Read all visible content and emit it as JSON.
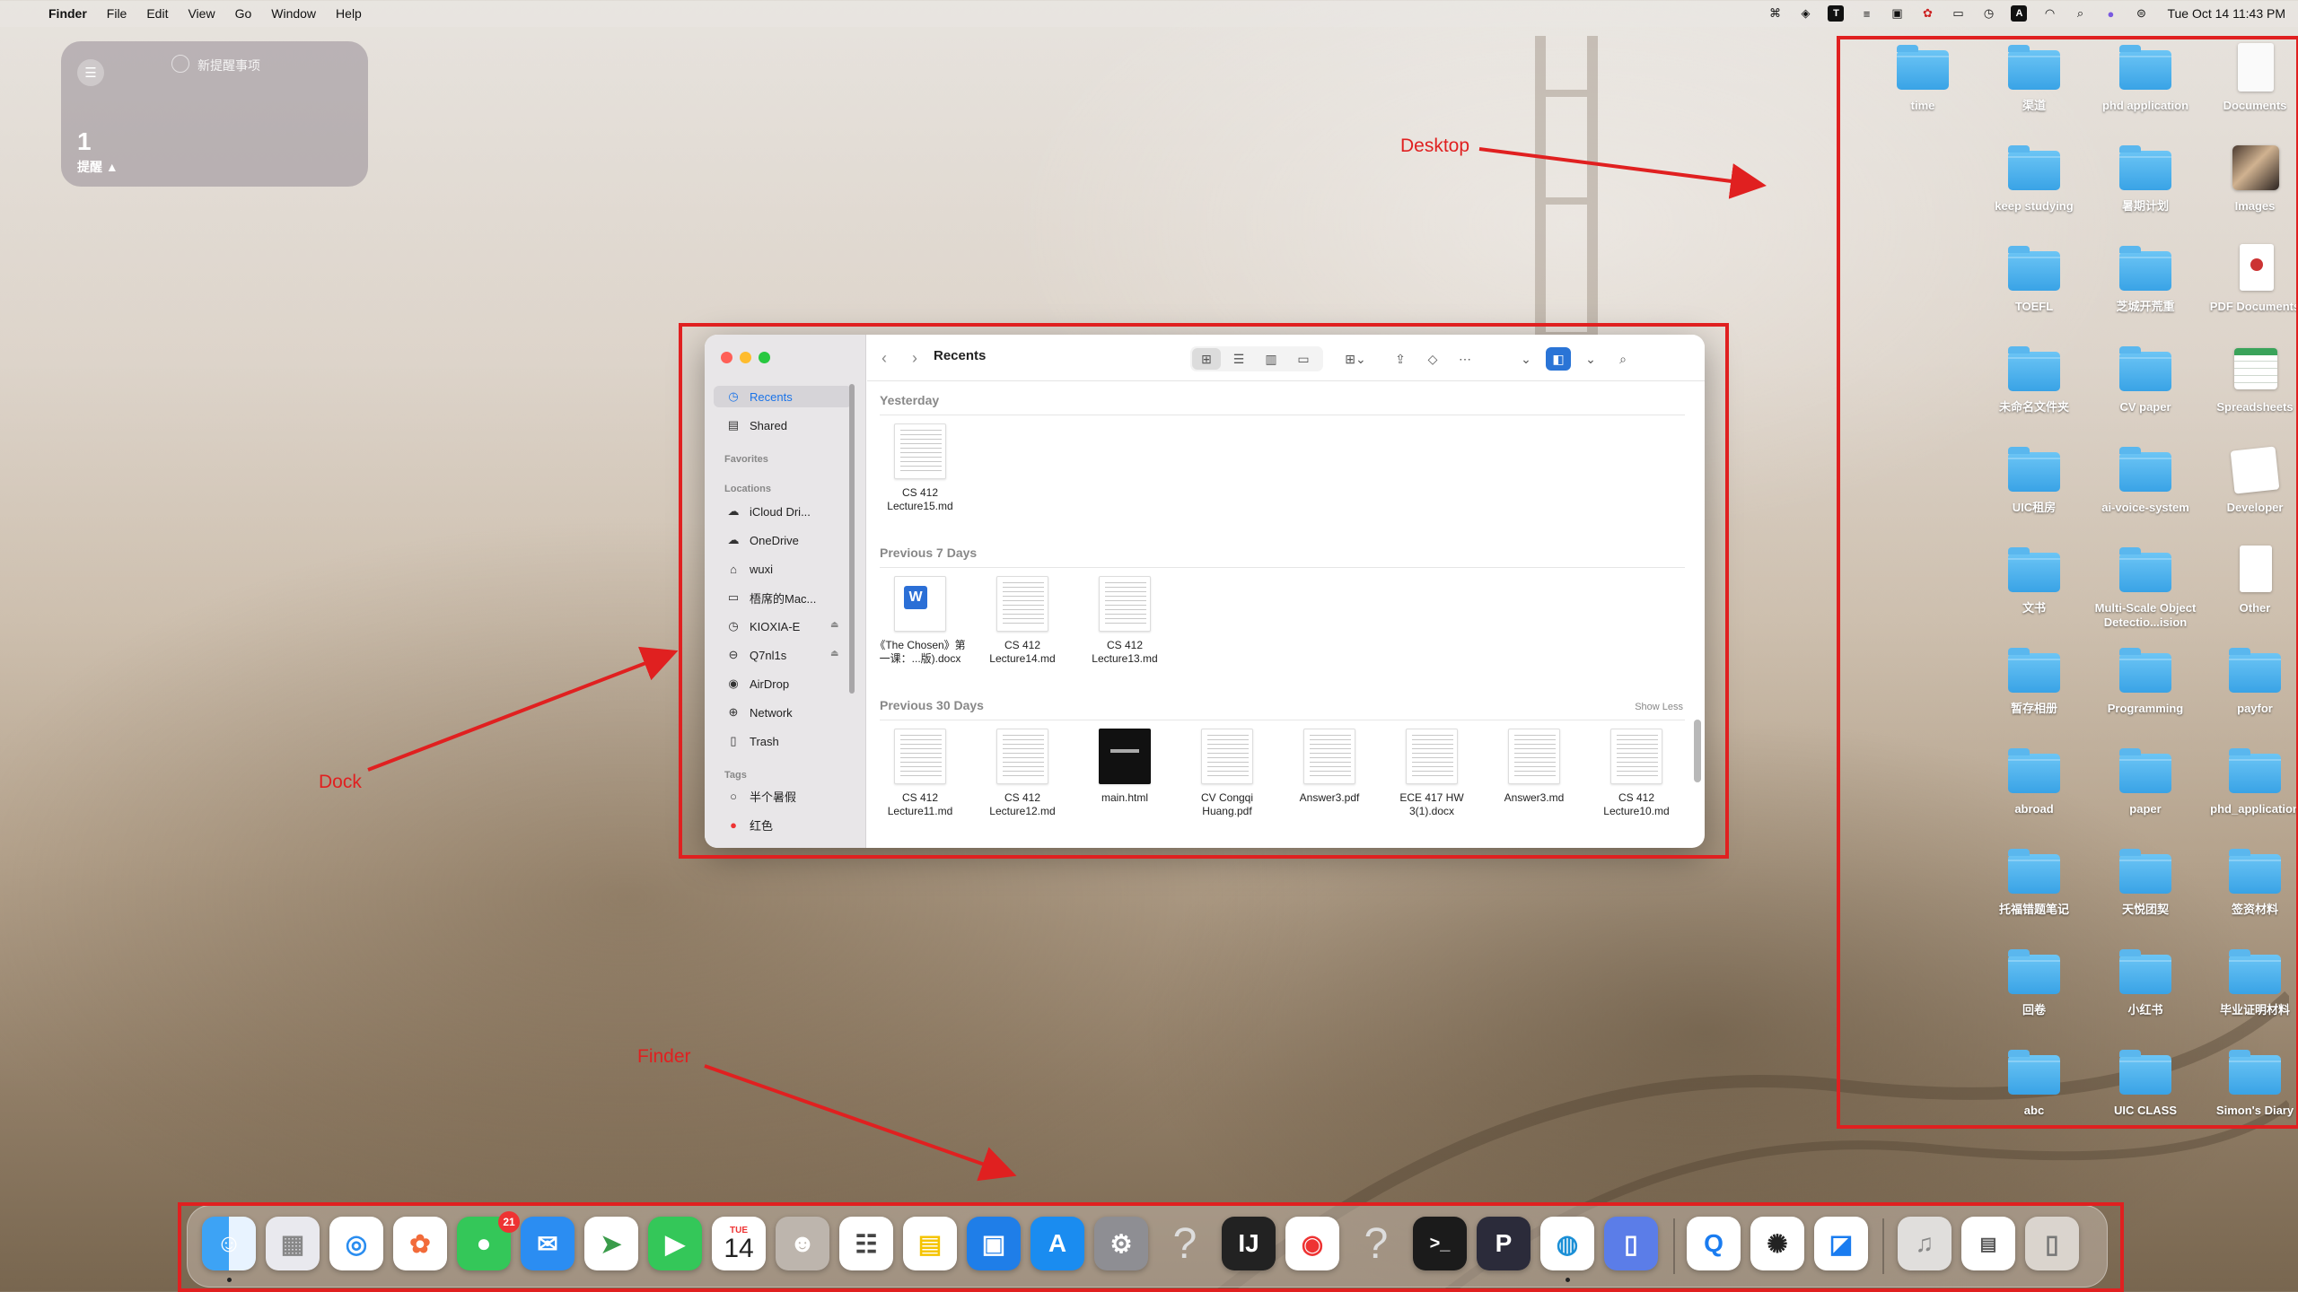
{
  "menubar": {
    "apple": "",
    "app_name": "Finder",
    "menus": [
      "File",
      "Edit",
      "View",
      "Go",
      "Window",
      "Help"
    ],
    "clock": "Tue Oct 14  11:43 PM",
    "status_icons": [
      "app-icon",
      "cube-icon",
      "text-box-icon",
      "stack-icon",
      "square-icon",
      "rocket-icon",
      "window-icon",
      "clock-icon",
      "input-source-icon",
      "wifi-icon",
      "search-icon",
      "siri-icon",
      "control-center-icon"
    ]
  },
  "widget": {
    "title": "新提醒事项",
    "count": "1",
    "label": "提醒 ▲"
  },
  "annotations": {
    "desktop": "Desktop",
    "dock": "Dock",
    "finder": "Finder"
  },
  "desktop": {
    "items": [
      {
        "label": "time",
        "kind": "folder"
      },
      {
        "label": "渠道",
        "kind": "folder"
      },
      {
        "label": "phd application",
        "kind": "folder"
      },
      {
        "label": "Documents",
        "kind": "doc"
      },
      {
        "label": "keep studying",
        "kind": "folder"
      },
      {
        "label": "暑期计划",
        "kind": "folder"
      },
      {
        "label": "Images",
        "kind": "image"
      },
      {
        "label": "TOEFL",
        "kind": "folder"
      },
      {
        "label": "芝城开荒重",
        "kind": "folder"
      },
      {
        "label": "PDF Documents",
        "kind": "pdf"
      },
      {
        "label": "未命名文件夹",
        "kind": "folder"
      },
      {
        "label": "CV paper",
        "kind": "folder"
      },
      {
        "label": "Spreadsheets",
        "kind": "sheet"
      },
      {
        "label": "UIC租房",
        "kind": "folder"
      },
      {
        "label": "ai-voice-system",
        "kind": "folder"
      },
      {
        "label": "Developer",
        "kind": "white"
      },
      {
        "label": "文书",
        "kind": "folder"
      },
      {
        "label": "Multi-Scale Object Detectio...ision",
        "kind": "folder"
      },
      {
        "label": "Other",
        "kind": "otherdoc"
      },
      {
        "label": "暂存相册",
        "kind": "folder"
      },
      {
        "label": "Programming",
        "kind": "folder"
      },
      {
        "label": "payfor",
        "kind": "folder"
      },
      {
        "label": "abroad",
        "kind": "folder"
      },
      {
        "label": "paper",
        "kind": "folder"
      },
      {
        "label": "phd_application",
        "kind": "folder"
      },
      {
        "label": "托福错题笔记",
        "kind": "folder"
      },
      {
        "label": "天悦团契",
        "kind": "folder"
      },
      {
        "label": "签资材料",
        "kind": "folder"
      },
      {
        "label": "回卷",
        "kind": "folder"
      },
      {
        "label": "小红书",
        "kind": "folder"
      },
      {
        "label": "毕业证明材料",
        "kind": "folder"
      },
      {
        "label": "abc",
        "kind": "folder"
      },
      {
        "label": "UIC CLASS",
        "kind": "folder"
      },
      {
        "label": "Simon's Diary",
        "kind": "folder"
      }
    ]
  },
  "finder": {
    "title": "Recents",
    "sidebar": {
      "recents": "Recents",
      "shared": "Shared",
      "favorites_header": "Favorites",
      "locations_header": "Locations",
      "locations": [
        "iCloud Dri...",
        "OneDrive",
        "wuxi",
        "梧席的Mac...",
        "KIOXIA-E",
        "Q7nl1s",
        "AirDrop",
        "Network",
        "Trash"
      ],
      "tags_header": "Tags",
      "tags": [
        "半个暑假",
        "红色"
      ]
    },
    "sections": {
      "yesterday": "Yesterday",
      "prev7": "Previous 7 Days",
      "prev30": "Previous 30 Days",
      "show_less": "Show Less"
    },
    "files_yesterday": [
      "CS 412 Lecture15.md"
    ],
    "files_prev7": [
      "《The Chosen》第一课：...版).docx",
      "CS 412 Lecture14.md",
      "CS 412 Lecture13.md"
    ],
    "files_prev30": [
      "CS 412 Lecture11.md",
      "CS 412 Lecture12.md",
      "main.html",
      "CV Congqi Huang.pdf",
      "Answer3.pdf",
      "ECE 417 HW 3(1).docx",
      "Answer3.md",
      "CS 412 Lecture10.md"
    ]
  },
  "dock": {
    "calendar_month": "TUE",
    "calendar_day": "14",
    "messages_badge": "21"
  },
  "colors": {
    "annotation_red": "#e02020",
    "folder_blue": "#39a3e6",
    "accent": "#1a73e8"
  }
}
